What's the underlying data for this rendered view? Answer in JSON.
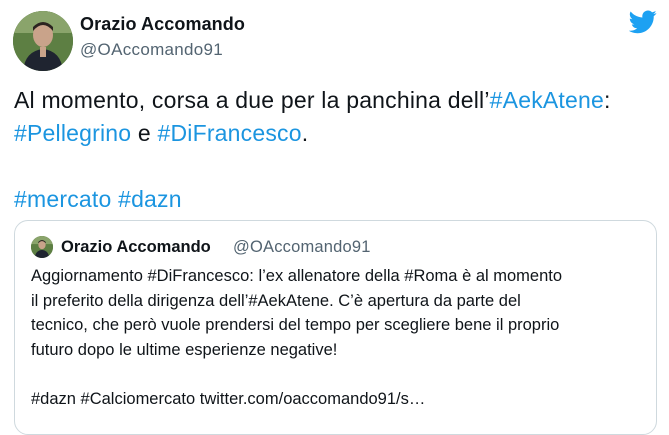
{
  "author": {
    "name": "Orazio Accomando",
    "handle": "@OAccomando91"
  },
  "tweet": {
    "line1_text": "Al momento, corsa a due per la panchina dell’",
    "line1_tag": "#AekAtene",
    "line1_colon": ":",
    "line2_tag1": "#Pellegrino",
    "line2_and": " e ",
    "line2_tag2": "#DiFrancesco",
    "line2_end": ".",
    "line3_tag1": "#mercato",
    "line3_tag2": "#dazn"
  },
  "quoted": {
    "name": "Orazio Accomando",
    "handle": "@OAccomando91",
    "line1": "Aggiornamento #DiFrancesco: l’ex allenatore della #Roma è al momento",
    "line2": "il preferito della dirigenza dell’#AekAtene. C’è apertura da parte del",
    "line3": "tecnico, che però vuole prendersi del tempo per scegliere bene il proprio",
    "line4": "futuro dopo le ultime esperienze negative!",
    "line5": "#dazn #Calciomercato twitter.com/oaccomando91/s…"
  },
  "colors": {
    "link": "#1b95e0",
    "twitter_blue": "#1da1f2",
    "secondary_text": "#536471",
    "border": "#cfd9de"
  },
  "icons": {
    "brand": "twitter-bird-icon"
  }
}
